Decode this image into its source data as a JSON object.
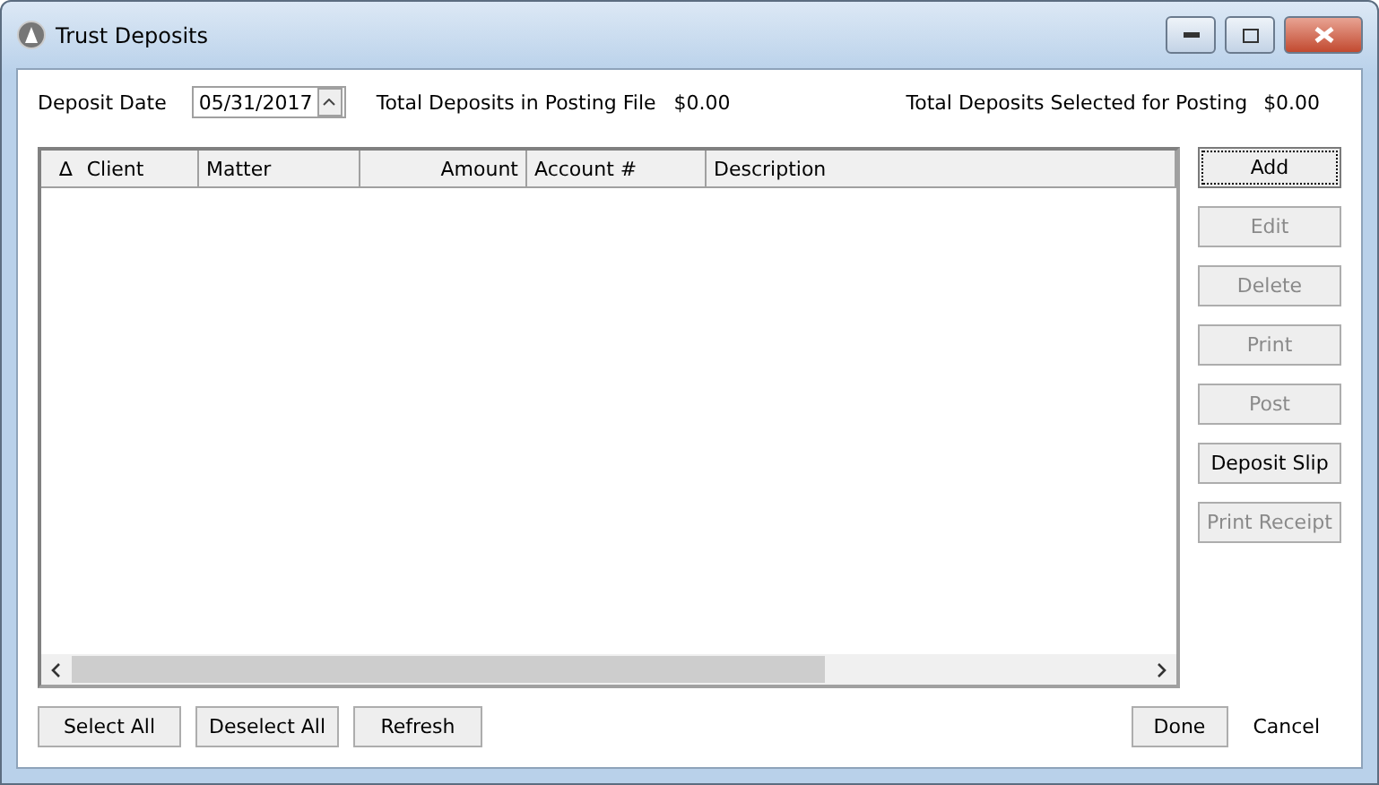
{
  "window": {
    "title": "Trust Deposits"
  },
  "deposit_date": {
    "label": "Deposit Date",
    "value": "05/31/2017"
  },
  "totals": [
    {
      "label": "Total Deposits in Posting File",
      "value": "$0.00"
    },
    {
      "label": "Total Deposits Selected for Posting",
      "value": "$0.00"
    }
  ],
  "table": {
    "sort_mark": "∆",
    "columns": [
      {
        "label": "Client",
        "numeric": false
      },
      {
        "label": "Matter",
        "numeric": false
      },
      {
        "label": "Amount",
        "numeric": true
      },
      {
        "label": "Account #",
        "numeric": false
      },
      {
        "label": "Description",
        "numeric": false
      }
    ]
  },
  "side_buttons": [
    {
      "label": "Add",
      "disabled": false,
      "focused": true
    },
    {
      "label": "Edit",
      "disabled": true,
      "focused": false
    },
    {
      "label": "Delete",
      "disabled": true,
      "focused": false
    },
    {
      "label": "Print",
      "disabled": true,
      "focused": false
    },
    {
      "label": "Post",
      "disabled": true,
      "focused": false
    },
    {
      "label": "Deposit Slip",
      "disabled": false,
      "focused": false
    },
    {
      "label": "Print Receipt",
      "disabled": true,
      "focused": false
    }
  ],
  "bottom_buttons": [
    "Select All",
    "Deselect All",
    "Refresh"
  ],
  "done_button": "Done",
  "cancel_link": "Cancel"
}
